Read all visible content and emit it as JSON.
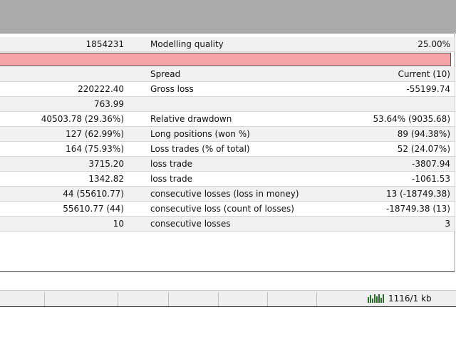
{
  "report": {
    "modelling": {
      "value": "1854231",
      "label": "Modelling quality",
      "right": "25.00%"
    },
    "rows": [
      {
        "c1": "",
        "c2": "Spread",
        "c3": "Current (10)"
      },
      {
        "c1": "220222.40",
        "c2": "Gross loss",
        "c3": "-55199.74"
      },
      {
        "c1": "763.99",
        "c2": "",
        "c3": ""
      },
      {
        "c1": "40503.78 (29.36%)",
        "c2": "Relative drawdown",
        "c3": "53.64% (9035.68)"
      },
      {
        "c1": "127 (62.99%)",
        "c2": "Long positions (won %)",
        "c3": "89 (94.38%)"
      },
      {
        "c1": "164 (75.93%)",
        "c2": "Loss trades (% of total)",
        "c3": "52 (24.07%)"
      },
      {
        "c1": "3715.20",
        "c2": "loss trade",
        "c3": "-3807.94"
      },
      {
        "c1": "1342.82",
        "c2": "loss trade",
        "c3": "-1061.53"
      },
      {
        "c1": "44 (55610.77)",
        "c2": "consecutive losses (loss in money)",
        "c3": "13 (-18749.38)"
      },
      {
        "c1": "55610.77 (44)",
        "c2": "consecutive loss (count of losses)",
        "c3": "-18749.38 (13)"
      },
      {
        "c1": "10",
        "c2": "consecutive losses",
        "c3": "3"
      }
    ]
  },
  "statusbar": {
    "traffic_icon": "traffic-bars-icon",
    "traffic_text": "1116/1 kb"
  },
  "colors": {
    "error_bar": "#f4a3a6",
    "traffic": "#2d6b2d"
  }
}
